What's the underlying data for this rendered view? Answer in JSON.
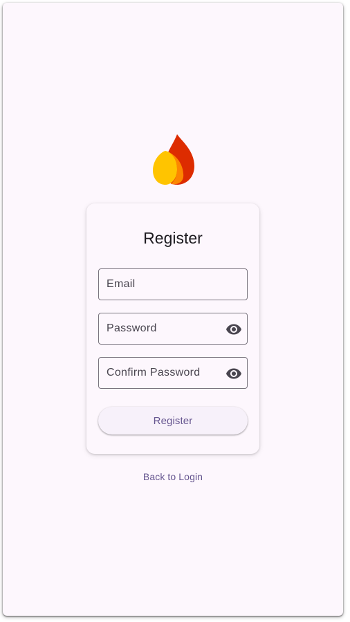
{
  "colors": {
    "background": "#fdf7fd",
    "primary": "#65558f",
    "outline": "#79747e",
    "on_surface": "#1d1b20",
    "logo_red": "#dd2c00",
    "logo_amber": "#ffc400",
    "logo_orange": "#ff9100"
  },
  "logo": {
    "icon": "flame-logo-icon"
  },
  "card": {
    "title": "Register",
    "fields": {
      "email": {
        "placeholder": "Email"
      },
      "password": {
        "placeholder": "Password",
        "toggle_icon": "eye-icon"
      },
      "confirm_password": {
        "placeholder": "Confirm Password",
        "toggle_icon": "eye-icon"
      }
    },
    "register_label": "Register"
  },
  "back_link_label": "Back to Login"
}
